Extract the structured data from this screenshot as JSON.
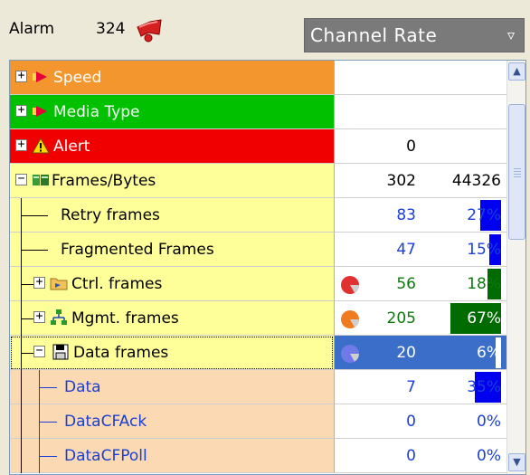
{
  "header": {
    "alarm_label": "Alarm",
    "alarm_count": "324",
    "dropdown_value": "Channel Rate",
    "dropdown_arrow": "▿"
  },
  "colors": {
    "speed_bg": "#f4962e",
    "media_bg": "#00c000",
    "alert_bg": "#f00000",
    "frames_bg": "#ffff99",
    "data_bg": "#fbd9b3",
    "selected_val_bg": "#3a6ec8",
    "bar_blue": "#0000ee",
    "bar_green": "#006b00"
  },
  "rows": [
    {
      "label": "Speed",
      "v1": "",
      "v2": "",
      "expander": "+"
    },
    {
      "label": "Media Type",
      "v1": "",
      "v2": "",
      "expander": "+"
    },
    {
      "label": "Alert",
      "v1": "0",
      "v2": "",
      "expander": "+"
    },
    {
      "label": "Frames/Bytes",
      "v1": "302",
      "v2": "44326",
      "expander": "−"
    },
    {
      "label": "Retry frames",
      "v1": "83",
      "v2": "27%",
      "fill": 0.27
    },
    {
      "label": "Fragmented Frames",
      "v1": "47",
      "v2": "15%",
      "fill": 0.15
    },
    {
      "label": "Ctrl. frames",
      "v1": "56",
      "v2": "18%",
      "expander": "+",
      "fill": 0.18
    },
    {
      "label": "Mgmt. frames",
      "v1": "205",
      "v2": "67%",
      "expander": "+",
      "fill": 0.67
    },
    {
      "label": "Data frames",
      "v1": "20",
      "v2": "6%",
      "expander": "−",
      "fill": 0.06
    },
    {
      "label": "Data",
      "v1": "7",
      "v2": "35%",
      "fill": 0.35
    },
    {
      "label": "DataCFAck",
      "v1": "0",
      "v2": "0%",
      "fill": 0
    },
    {
      "label": "DataCFPoll",
      "v1": "0",
      "v2": "0%",
      "fill": 0
    }
  ],
  "icons": {
    "alarm": "red-horn-icon",
    "speed": "speed-arrow-icon",
    "media": "media-arrow-icon",
    "alert": "warning-icon",
    "frames": "frames-icon",
    "ctrl": "folder-icon",
    "mgmt": "network-icon",
    "data": "floppy-disk-icon",
    "pie": "pie-chart-icon"
  }
}
